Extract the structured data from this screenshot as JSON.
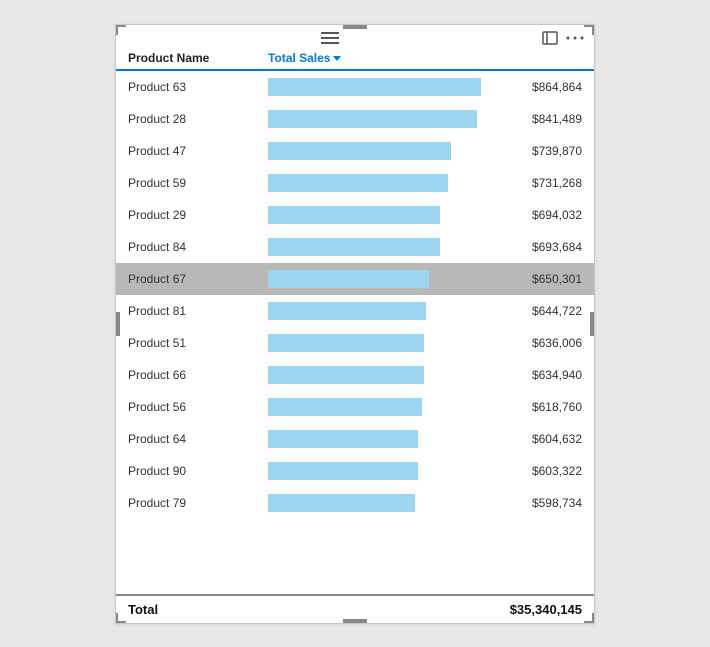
{
  "toolbar": {
    "expand_icon": "⊡",
    "more_icon": "..."
  },
  "table": {
    "col_name": "Product Name",
    "col_sales": "Total Sales",
    "rows": [
      {
        "name": "Product 63",
        "value": "$864,864",
        "bar_pct": 97
      },
      {
        "name": "Product 28",
        "value": "$841,489",
        "bar_pct": 95
      },
      {
        "name": "Product 47",
        "value": "$739,870",
        "bar_pct": 83
      },
      {
        "name": "Product 59",
        "value": "$731,268",
        "bar_pct": 82
      },
      {
        "name": "Product 29",
        "value": "$694,032",
        "bar_pct": 78
      },
      {
        "name": "Product 84",
        "value": "$693,684",
        "bar_pct": 78
      },
      {
        "name": "Product 67",
        "value": "$650,301",
        "bar_pct": 73,
        "highlighted": true
      },
      {
        "name": "Product 81",
        "value": "$644,722",
        "bar_pct": 72
      },
      {
        "name": "Product 51",
        "value": "$636,006",
        "bar_pct": 71
      },
      {
        "name": "Product 66",
        "value": "$634,940",
        "bar_pct": 71
      },
      {
        "name": "Product 56",
        "value": "$618,760",
        "bar_pct": 70
      },
      {
        "name": "Product 64",
        "value": "$604,632",
        "bar_pct": 68
      },
      {
        "name": "Product 90",
        "value": "$603,322",
        "bar_pct": 68
      },
      {
        "name": "Product 79",
        "value": "$598,734",
        "bar_pct": 67
      }
    ],
    "total_label": "Total",
    "total_value": "$35,340,145"
  }
}
